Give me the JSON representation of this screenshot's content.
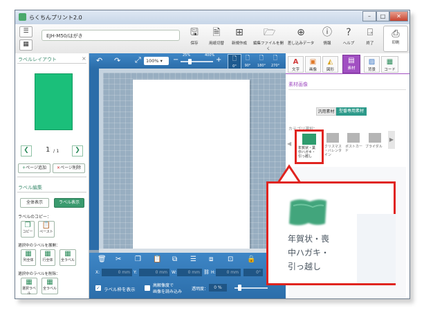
{
  "window": {
    "title": "らくちんプリント2.0"
  },
  "document": {
    "name": "EJH-M50/はがき"
  },
  "toolbar": {
    "items": [
      {
        "label": "保存",
        "icon": "save-icon"
      },
      {
        "label": "用紙切替",
        "icon": "paper-switch-icon"
      },
      {
        "label": "新規作成",
        "icon": "new-icon"
      },
      {
        "label": "編集ファイルを開く",
        "icon": "open-file-icon"
      },
      {
        "label": "差し込みデータ",
        "icon": "merge-data-icon"
      },
      {
        "label": "情報",
        "icon": "info-icon"
      },
      {
        "label": "ヘルプ",
        "icon": "help-icon"
      },
      {
        "label": "終了",
        "icon": "exit-icon"
      }
    ],
    "print_label": "印刷"
  },
  "left_panel": {
    "layout_title": "ラベルレイアウト",
    "page_current": "1",
    "page_total": "/ 1",
    "add_page": "ページ追加",
    "delete_page": "ページ削除",
    "edit_title": "ラベル編集",
    "show_all": "全体表示",
    "show_label": "ラベル表示",
    "copy_title": "ラベルのコピー：",
    "copy": "コピー",
    "paste": "ペースト",
    "expand_title": "選択中のラベルを展開：",
    "col_all": "列全体",
    "row_all": "行全体",
    "all_labels": "全ラベル",
    "delete_title": "選択中のラベルを削除：",
    "selected_label": "選択ラベル",
    "all_delete": "全ラベル"
  },
  "canvas": {
    "zoom": "100%",
    "zoom_min": "25%",
    "zoom_max": "400%",
    "rotations": [
      "0°",
      "90°",
      "180°",
      "270°"
    ],
    "x_label": "X:",
    "x_value": "0 mm",
    "y_label": "Y:",
    "y_value": "0 mm",
    "w_label": "W:",
    "w_value": "0 mm",
    "h_label": "H:",
    "h_value": "0 mm",
    "angle": "0°",
    "show_frame": "ラベル枠を表示",
    "hq_line1": "高解像度で",
    "hq_line2": "画像を読み込み",
    "opacity_label": "透明度：",
    "opacity_value": "0 %"
  },
  "right_panel": {
    "tabs": [
      "文字",
      "画像",
      "図形",
      "素材",
      "背景",
      "コード"
    ],
    "section_title": "素材画像",
    "toggle_general": "汎用素材",
    "toggle_paper": "型番専用素材",
    "category_label": "カテゴリ選択：",
    "categories": [
      {
        "line1": "年賀状・葉",
        "line2": "中ハガキ・",
        "line3": "引っ越し"
      },
      {
        "line1": "クリスマス",
        "line2": "・バレンタ",
        "line3": "イン"
      },
      {
        "line1": "ポストカー",
        "line2": "ド",
        "line3": ""
      },
      {
        "line1": "ブライダル",
        "line2": "",
        "line3": ""
      }
    ]
  },
  "callout": {
    "line1": "年賀状・喪",
    "line2": "中ハガキ・",
    "line3": "引っ越し"
  },
  "colors": {
    "accent": "#3a9a6e",
    "green_tile": "#1bbf7a",
    "highlight": "#e0241f",
    "canvas_blue": "#2b6da9"
  }
}
